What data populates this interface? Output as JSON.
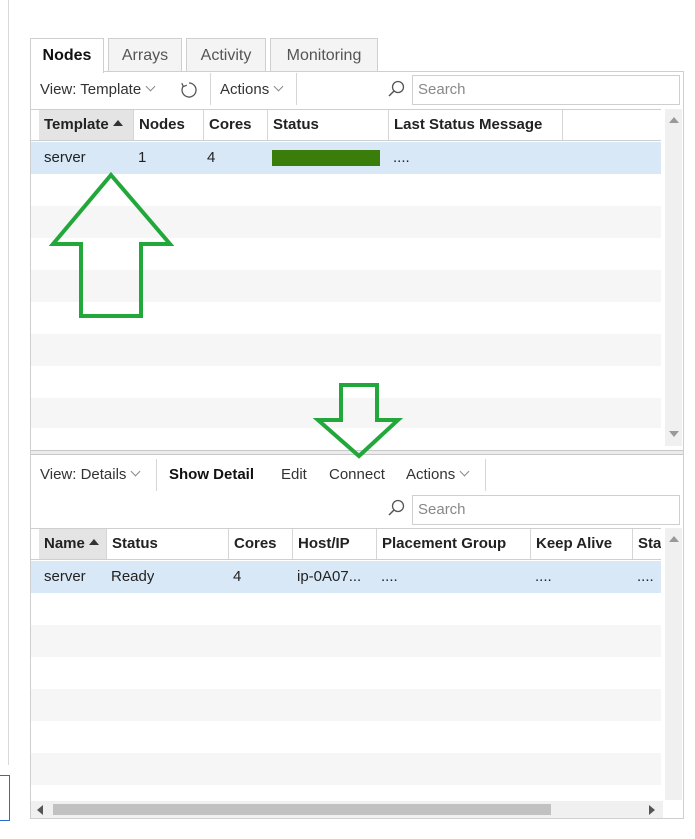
{
  "tabs": [
    {
      "label": "Nodes",
      "active": true
    },
    {
      "label": "Arrays",
      "active": false
    },
    {
      "label": "Activity",
      "active": false
    },
    {
      "label": "Monitoring",
      "active": false
    }
  ],
  "top_toolbar": {
    "view_label": "View: Template",
    "actions_label": "Actions",
    "search_placeholder": "Search"
  },
  "template_grid": {
    "columns": [
      "Template",
      "Nodes",
      "Cores",
      "Status",
      "Last Status Message"
    ],
    "sorted_column": "Template",
    "rows": [
      {
        "template": "server",
        "nodes": "1",
        "cores": "4",
        "status_color": "#3a7d0a",
        "message": "...."
      }
    ]
  },
  "bottom_toolbar": {
    "view_label": "View: Details",
    "show_detail_label": "Show Detail",
    "edit_label": "Edit",
    "connect_label": "Connect",
    "actions_label": "Actions",
    "search_placeholder": "Search"
  },
  "node_grid": {
    "columns": [
      "Name",
      "Status",
      "Cores",
      "Host/IP",
      "Placement Group",
      "Keep Alive",
      "Sta"
    ],
    "sorted_column": "Name",
    "rows": [
      {
        "name": "server",
        "status": "Ready",
        "cores": "4",
        "host": "ip-0A07...",
        "placement_group": "....",
        "keep_alive": "....",
        "sta": "...."
      }
    ]
  },
  "annotation_color": "#22a83a"
}
